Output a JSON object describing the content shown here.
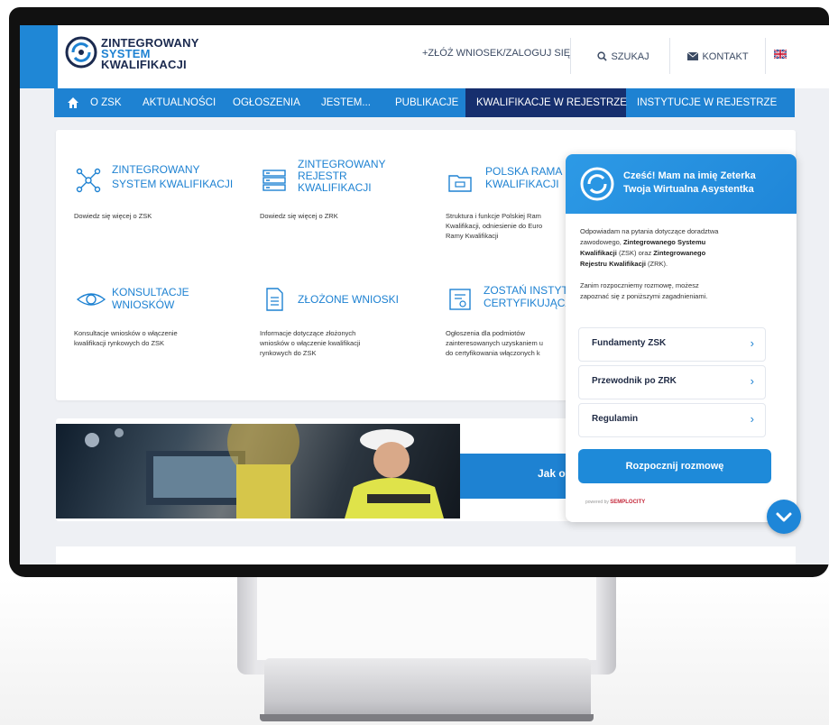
{
  "header": {
    "logo_line1": "ZINTEGROWANY",
    "logo_line2": "SYSTEM",
    "logo_line3": "KWALIFIKACJI",
    "login_link": "+ZŁÓŻ WNIOSEK/ZALOGUJ SIĘ",
    "search_label": "SZUKAJ",
    "contact_label": "KONTAKT"
  },
  "nav": {
    "items": [
      "O ZSK",
      "AKTUALNOŚCI",
      "OGŁOSZENIA",
      "JESTEM...",
      "PUBLIKACJE",
      "KWALIFIKACJE W REJESTRZE",
      "INSTYTUCJE W REJESTRZE"
    ]
  },
  "tiles": [
    {
      "title_1": "ZINTEGROWANY",
      "title_2": "SYSTEM KWALIFIKACJI",
      "desc": "Dowiedz się więcej o ZSK"
    },
    {
      "title_1": "ZINTEGROWANY",
      "title_2": "REJESTR",
      "title_3": "KWALIFIKACJI",
      "desc": "Dowiedz się więcej o ZRK"
    },
    {
      "title_1": "POLSKA RAMA",
      "title_2": "KWALIFIKACJI",
      "desc_1": "Struktura i funkcje Polskiej Ram",
      "desc_2": "Kwalifikacji, odniesienie do Euro",
      "desc_3": "Ramy Kwalifikacji"
    },
    {
      "title_1": "KONSULTACJE",
      "title_2": "WNIOSKÓW",
      "desc_1": "Konsultacje wniosków o włączenie",
      "desc_2": "kwalifikacji rynkowych do ZSK"
    },
    {
      "title_1": "ZŁOŻONE WNIOSKI",
      "desc_1": "Informacje dotyczące złożonych",
      "desc_2": "wniosków o włączenie kwalifikacji",
      "desc_3": "rynkowych do ZSK"
    },
    {
      "title_1": "ZOSTAŃ INSTYT",
      "title_2": "CERTYFIKUJĄCĄ",
      "desc_1": "Ogłoszenia dla podmiotów",
      "desc_2": "zainteresowanych uzyskaniem u",
      "desc_3": "do certyfikowania włączonych k"
    }
  ],
  "banner": {
    "text": "Jak o"
  },
  "chat": {
    "greeting_1": "Cześć! Mam na imię Zeterka",
    "greeting_2": "Twoja Wirtualna Asystentka",
    "intro_1": "Odpowiadam na pytania dotyczące doradztwa",
    "intro_2a": "zawodowego, ",
    "intro_2b": "Zintegrowanego Systemu",
    "intro_3a": "Kwalifikacji",
    "intro_3b": " (ZSK) oraz ",
    "intro_3c": "Zintegrowanego",
    "intro_4a": "Rejestru Kwalifikacji",
    "intro_4b": " (ZRK).",
    "prompt_1": "Zanim rozpoczniemy rozmowę, możesz",
    "prompt_2": "zapoznać się z poniższymi zagadnieniami.",
    "options": [
      "Fundamenty ZSK",
      "Przewodnik po ZRK",
      "Regulamin"
    ],
    "start_button": "Rozpocznij rozmowę",
    "powered_by": "powered by",
    "brand": "SEMPLOCITY"
  },
  "colors": {
    "accent": "#1e82d2",
    "nav_active": "#162f6e",
    "logo_dark": "#1b2a4f"
  }
}
